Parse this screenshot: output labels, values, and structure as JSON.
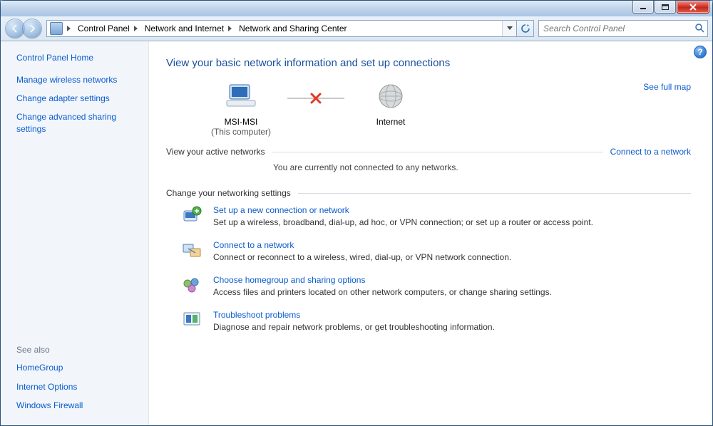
{
  "breadcrumbs": [
    "Control Panel",
    "Network and Internet",
    "Network and Sharing Center"
  ],
  "search": {
    "placeholder": "Search Control Panel"
  },
  "sidebar": {
    "home": "Control Panel Home",
    "items": [
      "Manage wireless networks",
      "Change adapter settings",
      "Change advanced sharing settings"
    ],
    "see_also_label": "See also",
    "see_also": [
      "HomeGroup",
      "Internet Options",
      "Windows Firewall"
    ]
  },
  "main": {
    "headline": "View your basic network information and set up connections",
    "full_map": "See full map",
    "nodes": {
      "computer_name": "MSI-MSI",
      "computer_sub": "(This computer)",
      "internet": "Internet"
    },
    "active_networks_label": "View your active networks",
    "connect_link": "Connect to a network",
    "not_connected": "You are currently not connected to any networks.",
    "change_settings_label": "Change your networking settings",
    "settings": [
      {
        "title": "Set up a new connection or network",
        "desc": "Set up a wireless, broadband, dial-up, ad hoc, or VPN connection; or set up a router or access point."
      },
      {
        "title": "Connect to a network",
        "desc": "Connect or reconnect to a wireless, wired, dial-up, or VPN network connection."
      },
      {
        "title": "Choose homegroup and sharing options",
        "desc": "Access files and printers located on other network computers, or change sharing settings."
      },
      {
        "title": "Troubleshoot problems",
        "desc": "Diagnose and repair network problems, or get troubleshooting information."
      }
    ]
  }
}
